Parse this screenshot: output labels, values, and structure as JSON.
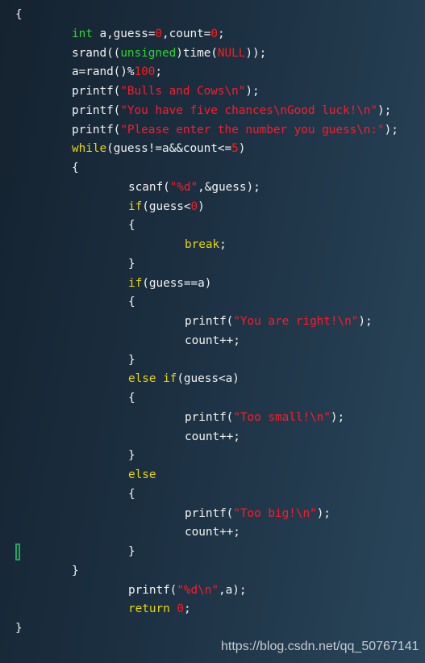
{
  "colors": {
    "background": "#1c3042",
    "keyword": "#2ed52e",
    "control": "#e8d80a",
    "number": "#ff1a1a",
    "string": "#ff1a2a",
    "text": "#f2f2f2",
    "cursor": "#1fa85a"
  },
  "code_lines": [
    {
      "indent": 0,
      "tokens": [
        [
          "txt",
          "{"
        ]
      ]
    },
    {
      "indent": 1,
      "tokens": [
        [
          "kw",
          "int"
        ],
        [
          "txt",
          " a,guess="
        ],
        [
          "num",
          "0"
        ],
        [
          "txt",
          ",count="
        ],
        [
          "num",
          "0"
        ],
        [
          "txt",
          ";"
        ]
      ]
    },
    {
      "indent": 1,
      "tokens": [
        [
          "txt",
          "srand(("
        ],
        [
          "kw",
          "unsigned"
        ],
        [
          "txt",
          ")time("
        ],
        [
          "num",
          "NULL"
        ],
        [
          "txt",
          "));"
        ]
      ]
    },
    {
      "indent": 1,
      "tokens": [
        [
          "txt",
          "a=rand()%"
        ],
        [
          "num",
          "100"
        ],
        [
          "txt",
          ";"
        ]
      ]
    },
    {
      "indent": 1,
      "tokens": [
        [
          "txt",
          "printf("
        ],
        [
          "str",
          "\"Bulls and Cows\\n\""
        ],
        [
          "txt",
          ");"
        ]
      ]
    },
    {
      "indent": 1,
      "tokens": [
        [
          "txt",
          "printf("
        ],
        [
          "str",
          "\"You have five chances\\nGood luck!\\n\""
        ],
        [
          "txt",
          ");"
        ]
      ]
    },
    {
      "indent": 1,
      "tokens": [
        [
          "txt",
          "printf("
        ],
        [
          "str",
          "\"Please enter the number you guess\\n:\""
        ],
        [
          "txt",
          ");"
        ]
      ]
    },
    {
      "indent": 1,
      "tokens": [
        [
          "ctl",
          "while"
        ],
        [
          "txt",
          "(guess!=a&&count<="
        ],
        [
          "num",
          "5"
        ],
        [
          "txt",
          ")"
        ]
      ]
    },
    {
      "indent": 1,
      "tokens": [
        [
          "txt",
          "{"
        ]
      ]
    },
    {
      "indent": 2,
      "tokens": [
        [
          "txt",
          "scanf("
        ],
        [
          "str",
          "\"%d\""
        ],
        [
          "txt",
          ",&guess);"
        ]
      ]
    },
    {
      "indent": 2,
      "tokens": [
        [
          "ctl",
          "if"
        ],
        [
          "txt",
          "(guess<"
        ],
        [
          "num",
          "0"
        ],
        [
          "txt",
          ")"
        ]
      ]
    },
    {
      "indent": 2,
      "tokens": [
        [
          "txt",
          "{"
        ]
      ]
    },
    {
      "indent": 3,
      "tokens": [
        [
          "ctl",
          "break"
        ],
        [
          "txt",
          ";"
        ]
      ]
    },
    {
      "indent": 2,
      "tokens": [
        [
          "txt",
          "}"
        ]
      ]
    },
    {
      "indent": 2,
      "tokens": [
        [
          "ctl",
          "if"
        ],
        [
          "txt",
          "(guess==a)"
        ]
      ]
    },
    {
      "indent": 2,
      "tokens": [
        [
          "txt",
          "{"
        ]
      ]
    },
    {
      "indent": 3,
      "tokens": [
        [
          "txt",
          "printf("
        ],
        [
          "str",
          "\"You are right!\\n\""
        ],
        [
          "txt",
          ");"
        ]
      ]
    },
    {
      "indent": 3,
      "tokens": [
        [
          "txt",
          "count++;"
        ]
      ]
    },
    {
      "indent": 2,
      "tokens": [
        [
          "txt",
          "}"
        ]
      ]
    },
    {
      "indent": 2,
      "tokens": [
        [
          "ctl",
          "else if"
        ],
        [
          "txt",
          "(guess<a)"
        ]
      ]
    },
    {
      "indent": 2,
      "tokens": [
        [
          "txt",
          "{"
        ]
      ]
    },
    {
      "indent": 3,
      "tokens": [
        [
          "txt",
          "printf("
        ],
        [
          "str",
          "\"Too small!\\n\""
        ],
        [
          "txt",
          ");"
        ]
      ]
    },
    {
      "indent": 3,
      "tokens": [
        [
          "txt",
          "count++;"
        ]
      ]
    },
    {
      "indent": 2,
      "tokens": [
        [
          "txt",
          "}"
        ]
      ]
    },
    {
      "indent": 2,
      "tokens": [
        [
          "ctl",
          "else"
        ]
      ]
    },
    {
      "indent": 2,
      "tokens": [
        [
          "txt",
          "{"
        ]
      ]
    },
    {
      "indent": 3,
      "tokens": [
        [
          "txt",
          "printf("
        ],
        [
          "str",
          "\"Too big!\\n\""
        ],
        [
          "txt",
          ");"
        ]
      ]
    },
    {
      "indent": 3,
      "tokens": [
        [
          "txt",
          "count++;"
        ]
      ]
    },
    {
      "indent": 2,
      "tokens": [
        [
          "txt",
          "}"
        ]
      ]
    },
    {
      "indent": 1,
      "tokens": [
        [
          "txt",
          "}"
        ]
      ]
    },
    {
      "indent": 2,
      "tokens": [
        [
          "txt",
          "printf("
        ],
        [
          "str",
          "\"%d\\n\""
        ],
        [
          "txt",
          ",a);"
        ]
      ]
    },
    {
      "indent": 2,
      "tokens": [
        [
          "ctl",
          "return"
        ],
        [
          "txt",
          " "
        ],
        [
          "num",
          "0"
        ],
        [
          "txt",
          ";"
        ]
      ]
    },
    {
      "indent": 0,
      "tokens": [
        [
          "txt",
          "}"
        ]
      ]
    }
  ],
  "watermark": "https://blog.csdn.net/qq_50767141"
}
